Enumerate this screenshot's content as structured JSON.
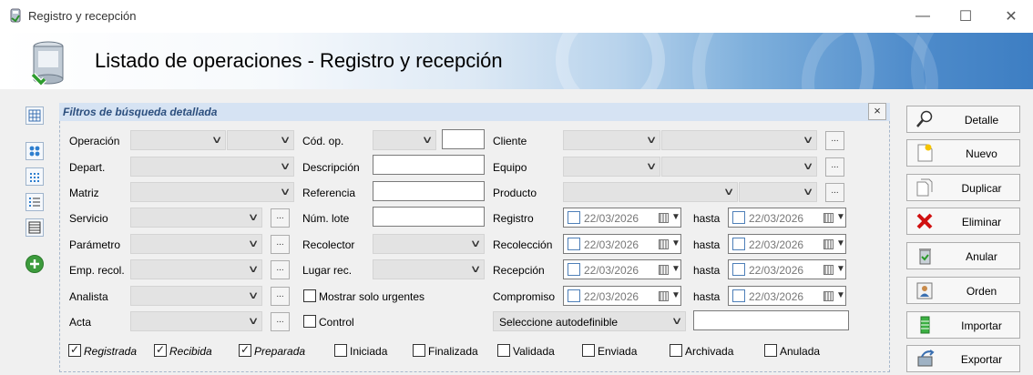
{
  "window": {
    "title": "Registro y recepción",
    "controls": {
      "minimize": "—",
      "maximize": "☐",
      "close": "✕"
    }
  },
  "header": {
    "title": "Listado de operaciones - Registro y recepción"
  },
  "filters": {
    "title": "Filtros de búsqueda detallada",
    "close": "×",
    "ellipsis": "...",
    "labels": {
      "operacion": "Operación",
      "depart": "Depart.",
      "matriz": "Matriz",
      "servicio": "Servicio",
      "parametro": "Parámetro",
      "emp_recol": "Emp. recol.",
      "analista": "Analista",
      "acta": "Acta",
      "cod_op": "Cód. op.",
      "descripcion": "Descripción",
      "referencia": "Referencia",
      "num_lote": "Núm. lote",
      "recolector": "Recolector",
      "lugar_rec": "Lugar rec.",
      "cliente": "Cliente",
      "equipo": "Equipo",
      "producto": "Producto",
      "registro": "Registro",
      "recoleccion": "Recolección",
      "recepcion": "Recepción",
      "compromiso": "Compromiso",
      "hasta": "hasta"
    },
    "mostrar_urgentes": "Mostrar solo urgentes",
    "control": "Control",
    "autodefinible_placeholder": "Seleccione autodefinible",
    "dates": {
      "registro_from": "22/03/2026",
      "registro_to": "22/03/2026",
      "recoleccion_from": "22/03/2026",
      "recoleccion_to": "22/03/2026",
      "recepcion_from": "22/03/2026",
      "recepcion_to": "22/03/2026",
      "compromiso_from": "22/03/2026",
      "compromiso_to": "22/03/2026"
    },
    "states": [
      {
        "label": "Registrada",
        "checked": true,
        "italic": true
      },
      {
        "label": "Recibida",
        "checked": true,
        "italic": true
      },
      {
        "label": "Preparada",
        "checked": true,
        "italic": true
      },
      {
        "label": "Iniciada",
        "checked": false,
        "italic": false
      },
      {
        "label": "Finalizada",
        "checked": false,
        "italic": false
      },
      {
        "label": "Validada",
        "checked": false,
        "italic": false
      },
      {
        "label": "Enviada",
        "checked": false,
        "italic": false
      },
      {
        "label": "Archivada",
        "checked": false,
        "italic": false
      },
      {
        "label": "Anulada",
        "checked": false,
        "italic": false
      }
    ]
  },
  "actions": {
    "detalle": "Detalle",
    "nuevo": "Nuevo",
    "duplicar": "Duplicar",
    "eliminar": "Eliminar",
    "anular": "Anular",
    "orden": "Orden",
    "importar": "Importar",
    "exportar": "Exportar"
  },
  "colors": {
    "panel_header": "#d6e3f3",
    "panel_title": "#2c4f7e",
    "banner_blue": "#3d7ec3"
  }
}
